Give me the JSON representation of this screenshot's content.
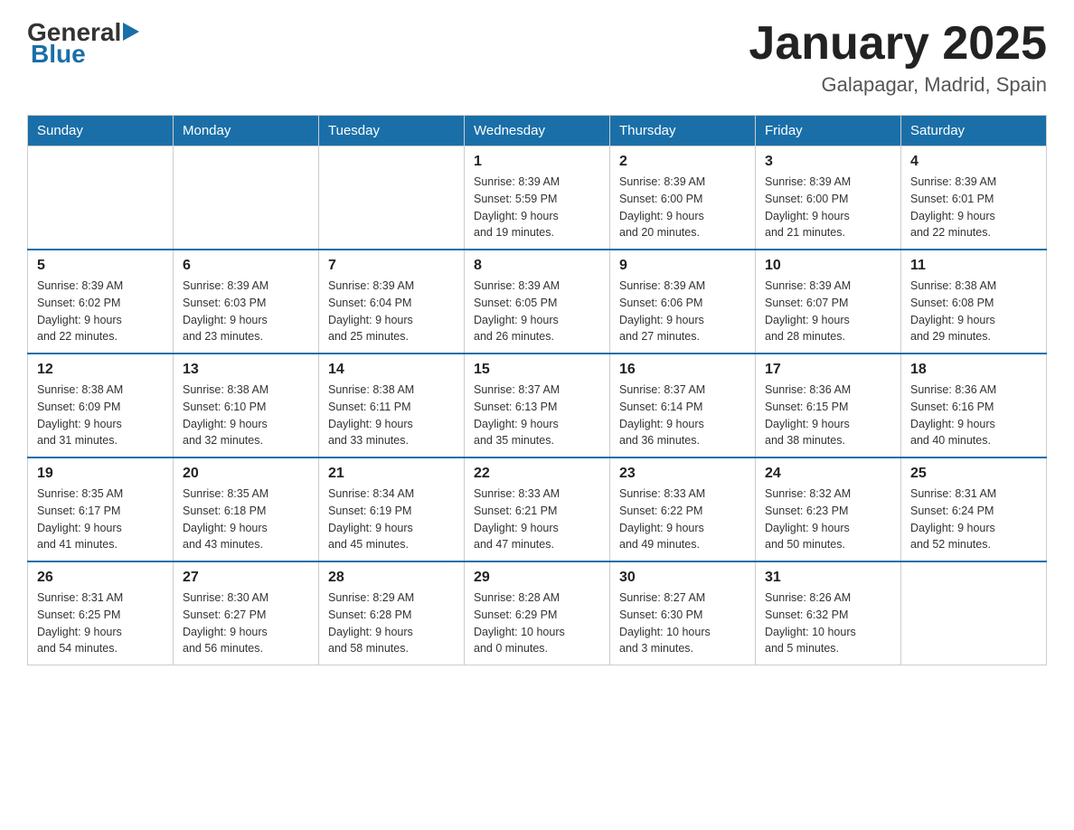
{
  "header": {
    "logo_general": "General",
    "logo_blue": "Blue",
    "month_year": "January 2025",
    "location": "Galapagar, Madrid, Spain"
  },
  "days_of_week": [
    "Sunday",
    "Monday",
    "Tuesday",
    "Wednesday",
    "Thursday",
    "Friday",
    "Saturday"
  ],
  "weeks": [
    [
      {
        "day": "",
        "info": ""
      },
      {
        "day": "",
        "info": ""
      },
      {
        "day": "",
        "info": ""
      },
      {
        "day": "1",
        "info": "Sunrise: 8:39 AM\nSunset: 5:59 PM\nDaylight: 9 hours\nand 19 minutes."
      },
      {
        "day": "2",
        "info": "Sunrise: 8:39 AM\nSunset: 6:00 PM\nDaylight: 9 hours\nand 20 minutes."
      },
      {
        "day": "3",
        "info": "Sunrise: 8:39 AM\nSunset: 6:00 PM\nDaylight: 9 hours\nand 21 minutes."
      },
      {
        "day": "4",
        "info": "Sunrise: 8:39 AM\nSunset: 6:01 PM\nDaylight: 9 hours\nand 22 minutes."
      }
    ],
    [
      {
        "day": "5",
        "info": "Sunrise: 8:39 AM\nSunset: 6:02 PM\nDaylight: 9 hours\nand 22 minutes."
      },
      {
        "day": "6",
        "info": "Sunrise: 8:39 AM\nSunset: 6:03 PM\nDaylight: 9 hours\nand 23 minutes."
      },
      {
        "day": "7",
        "info": "Sunrise: 8:39 AM\nSunset: 6:04 PM\nDaylight: 9 hours\nand 25 minutes."
      },
      {
        "day": "8",
        "info": "Sunrise: 8:39 AM\nSunset: 6:05 PM\nDaylight: 9 hours\nand 26 minutes."
      },
      {
        "day": "9",
        "info": "Sunrise: 8:39 AM\nSunset: 6:06 PM\nDaylight: 9 hours\nand 27 minutes."
      },
      {
        "day": "10",
        "info": "Sunrise: 8:39 AM\nSunset: 6:07 PM\nDaylight: 9 hours\nand 28 minutes."
      },
      {
        "day": "11",
        "info": "Sunrise: 8:38 AM\nSunset: 6:08 PM\nDaylight: 9 hours\nand 29 minutes."
      }
    ],
    [
      {
        "day": "12",
        "info": "Sunrise: 8:38 AM\nSunset: 6:09 PM\nDaylight: 9 hours\nand 31 minutes."
      },
      {
        "day": "13",
        "info": "Sunrise: 8:38 AM\nSunset: 6:10 PM\nDaylight: 9 hours\nand 32 minutes."
      },
      {
        "day": "14",
        "info": "Sunrise: 8:38 AM\nSunset: 6:11 PM\nDaylight: 9 hours\nand 33 minutes."
      },
      {
        "day": "15",
        "info": "Sunrise: 8:37 AM\nSunset: 6:13 PM\nDaylight: 9 hours\nand 35 minutes."
      },
      {
        "day": "16",
        "info": "Sunrise: 8:37 AM\nSunset: 6:14 PM\nDaylight: 9 hours\nand 36 minutes."
      },
      {
        "day": "17",
        "info": "Sunrise: 8:36 AM\nSunset: 6:15 PM\nDaylight: 9 hours\nand 38 minutes."
      },
      {
        "day": "18",
        "info": "Sunrise: 8:36 AM\nSunset: 6:16 PM\nDaylight: 9 hours\nand 40 minutes."
      }
    ],
    [
      {
        "day": "19",
        "info": "Sunrise: 8:35 AM\nSunset: 6:17 PM\nDaylight: 9 hours\nand 41 minutes."
      },
      {
        "day": "20",
        "info": "Sunrise: 8:35 AM\nSunset: 6:18 PM\nDaylight: 9 hours\nand 43 minutes."
      },
      {
        "day": "21",
        "info": "Sunrise: 8:34 AM\nSunset: 6:19 PM\nDaylight: 9 hours\nand 45 minutes."
      },
      {
        "day": "22",
        "info": "Sunrise: 8:33 AM\nSunset: 6:21 PM\nDaylight: 9 hours\nand 47 minutes."
      },
      {
        "day": "23",
        "info": "Sunrise: 8:33 AM\nSunset: 6:22 PM\nDaylight: 9 hours\nand 49 minutes."
      },
      {
        "day": "24",
        "info": "Sunrise: 8:32 AM\nSunset: 6:23 PM\nDaylight: 9 hours\nand 50 minutes."
      },
      {
        "day": "25",
        "info": "Sunrise: 8:31 AM\nSunset: 6:24 PM\nDaylight: 9 hours\nand 52 minutes."
      }
    ],
    [
      {
        "day": "26",
        "info": "Sunrise: 8:31 AM\nSunset: 6:25 PM\nDaylight: 9 hours\nand 54 minutes."
      },
      {
        "day": "27",
        "info": "Sunrise: 8:30 AM\nSunset: 6:27 PM\nDaylight: 9 hours\nand 56 minutes."
      },
      {
        "day": "28",
        "info": "Sunrise: 8:29 AM\nSunset: 6:28 PM\nDaylight: 9 hours\nand 58 minutes."
      },
      {
        "day": "29",
        "info": "Sunrise: 8:28 AM\nSunset: 6:29 PM\nDaylight: 10 hours\nand 0 minutes."
      },
      {
        "day": "30",
        "info": "Sunrise: 8:27 AM\nSunset: 6:30 PM\nDaylight: 10 hours\nand 3 minutes."
      },
      {
        "day": "31",
        "info": "Sunrise: 8:26 AM\nSunset: 6:32 PM\nDaylight: 10 hours\nand 5 minutes."
      },
      {
        "day": "",
        "info": ""
      }
    ]
  ]
}
